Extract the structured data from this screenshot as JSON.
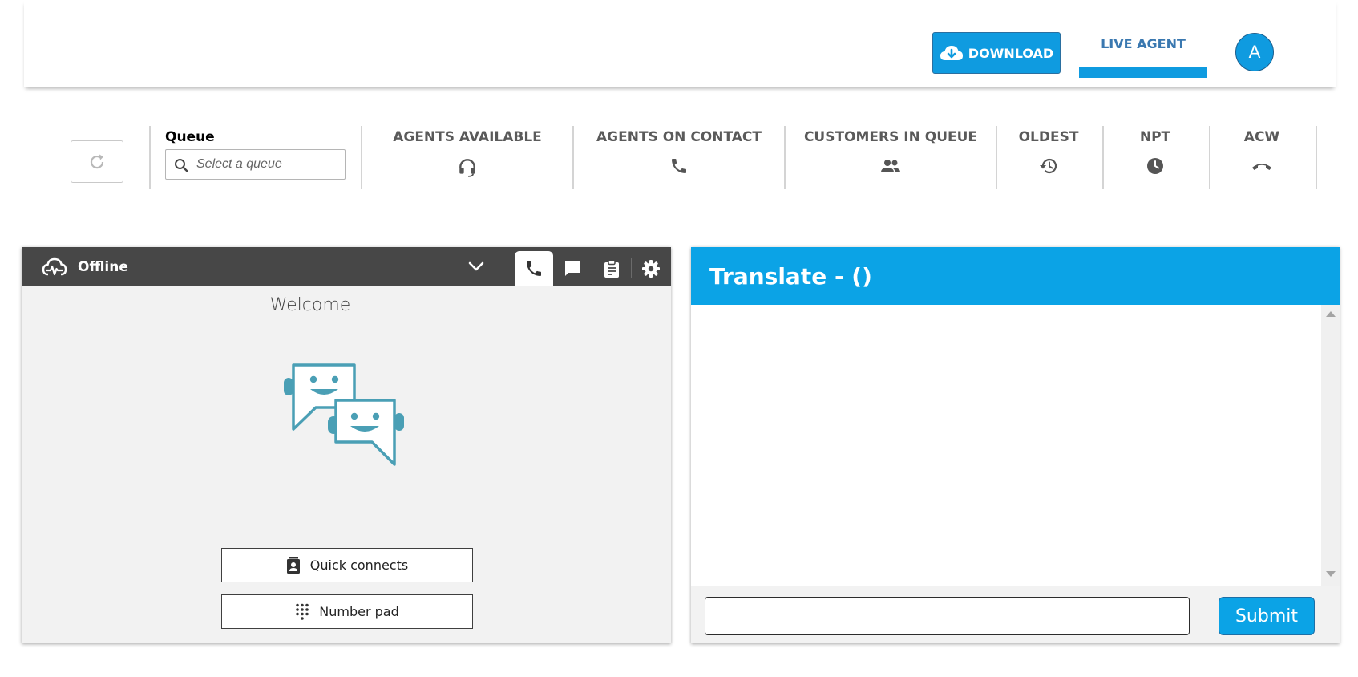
{
  "header": {
    "download_label": "DOWNLOAD",
    "live_agent_label": "LIVE AGENT",
    "avatar_initial": "A"
  },
  "stats": {
    "queue_label": "Queue",
    "queue_placeholder": "Select a queue",
    "items": [
      {
        "label": "AGENTS AVAILABLE",
        "icon": "headset-icon"
      },
      {
        "label": "AGENTS ON CONTACT",
        "icon": "phone-icon"
      },
      {
        "label": "CUSTOMERS IN QUEUE",
        "icon": "people-icon"
      },
      {
        "label": "OLDEST",
        "icon": "history-icon"
      },
      {
        "label": "NPT",
        "icon": "clock-icon"
      },
      {
        "label": "ACW",
        "icon": "hang-up-icon"
      }
    ]
  },
  "ccp": {
    "status": "Offline",
    "welcome": "Welcome",
    "quick_connects_label": "Quick connects",
    "number_pad_label": "Number pad",
    "tabs": [
      "phone-icon",
      "chat-icon",
      "clipboard-icon",
      "gear-icon"
    ]
  },
  "translate": {
    "title": "Translate - ()",
    "input_value": "",
    "submit_label": "Submit"
  },
  "colors": {
    "accent": "#0ba3e6",
    "ccp_bar": "#474747",
    "stat_text": "#5a5a5a",
    "illustration": "#4a9fb5"
  }
}
